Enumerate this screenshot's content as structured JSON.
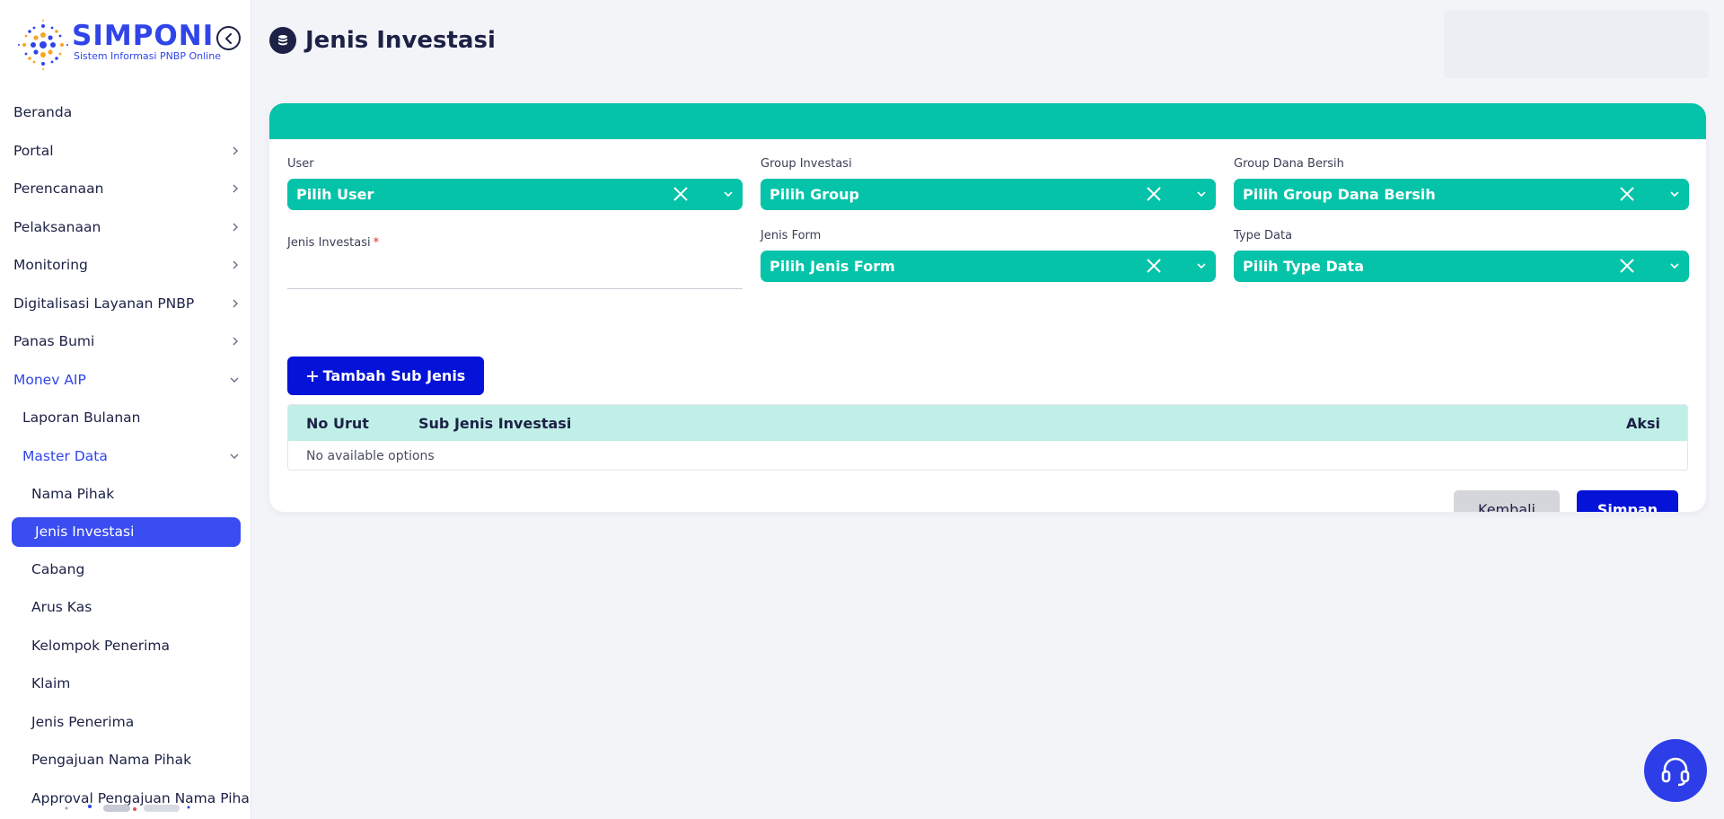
{
  "brand": {
    "title": "SIMPONI",
    "subtitle": "Sistem Informasi PNBP Online",
    "accent": "#3045e8"
  },
  "sidebar": {
    "items": [
      {
        "label": "Beranda",
        "level": 1,
        "chevron": "none"
      },
      {
        "label": "Portal",
        "level": 1,
        "chevron": "right"
      },
      {
        "label": "Perencanaan",
        "level": 1,
        "chevron": "right"
      },
      {
        "label": "Pelaksanaan",
        "level": 1,
        "chevron": "right"
      },
      {
        "label": "Monitoring",
        "level": 1,
        "chevron": "right"
      },
      {
        "label": "Digitalisasi Layanan PNBP",
        "level": 1,
        "chevron": "right"
      },
      {
        "label": "Panas Bumi",
        "level": 1,
        "chevron": "right"
      },
      {
        "label": "Monev AIP",
        "level": 1,
        "chevron": "down",
        "open": true
      },
      {
        "label": "Laporan Bulanan",
        "level": 2,
        "chevron": "none"
      },
      {
        "label": "Master Data",
        "level": 2,
        "chevron": "down",
        "open": true
      },
      {
        "label": "Nama Pihak",
        "level": 3,
        "chevron": "none"
      },
      {
        "label": "Jenis Investasi",
        "level": 3,
        "chevron": "none",
        "active": true
      },
      {
        "label": "Cabang",
        "level": 3,
        "chevron": "none"
      },
      {
        "label": "Arus Kas",
        "level": 3,
        "chevron": "none"
      },
      {
        "label": "Kelompok Penerima",
        "level": 3,
        "chevron": "none"
      },
      {
        "label": "Klaim",
        "level": 3,
        "chevron": "none"
      },
      {
        "label": "Jenis Penerima",
        "level": 3,
        "chevron": "none"
      },
      {
        "label": "Pengajuan Nama Pihak",
        "level": 3,
        "chevron": "none"
      },
      {
        "label": "Approval Pengajuan Nama Pihak",
        "level": 3,
        "chevron": "none"
      }
    ]
  },
  "page": {
    "title": "Jenis Investasi"
  },
  "form": {
    "user": {
      "label": "User",
      "value": "Pilih User"
    },
    "group_investasi": {
      "label": "Group Investasi",
      "value": "Pilih Group"
    },
    "group_dana_bersih": {
      "label": "Group Dana Bersih",
      "value": "Pilih Group Dana Bersih"
    },
    "jenis_investasi": {
      "label": "Jenis Investasi",
      "required_mark": "*",
      "value": ""
    },
    "jenis_form": {
      "label": "Jenis Form",
      "value": "Pilih Jenis Form"
    },
    "type_data": {
      "label": "Type Data",
      "value": "Pilih Type Data"
    }
  },
  "actions": {
    "add_sub_label": "Tambah Sub Jenis",
    "back_label": "Kembali",
    "save_label": "Simpan"
  },
  "table": {
    "columns": [
      "No Urut",
      "Sub Jenis Investasi",
      "Aksi"
    ],
    "empty_text": "No available options"
  },
  "colors": {
    "primary": "#0512d8",
    "teal": "#05c3a8",
    "table_header": "#c0efe8",
    "sidebar_active": "#3a4df0"
  },
  "icons": {
    "page": "coins-icon",
    "help": "headset-icon",
    "clear": "close-icon",
    "caret": "chevron-down-icon"
  }
}
